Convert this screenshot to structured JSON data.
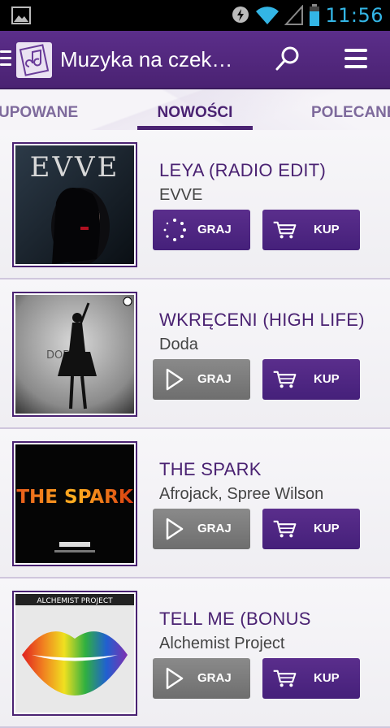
{
  "status_bar": {
    "time": "11:56",
    "icons": [
      "image-icon",
      "battery-saver-icon",
      "wifi-icon",
      "signal-icon",
      "battery-icon"
    ]
  },
  "action_bar": {
    "title": "Muzyka na czek…",
    "icons": [
      "app-music-icon",
      "search-icon",
      "menu-icon"
    ]
  },
  "tabs": [
    {
      "label": "UPOWANE"
    },
    {
      "label": "NOWOŚCI"
    },
    {
      "label": "POLECANE"
    }
  ],
  "songs": [
    {
      "title": "LEYA (RADIO EDIT)",
      "artist": "EVVE",
      "play_label": "GRAJ",
      "buy_label": "KUP",
      "play_state": "loading",
      "cover_text": "EVVE"
    },
    {
      "title": "WKRĘCENI (HIGH LIFE)",
      "artist": "Doda",
      "play_label": "GRAJ",
      "buy_label": "KUP",
      "play_state": "idle",
      "cover_text": "DODA"
    },
    {
      "title": "THE SPARK",
      "artist": "Afrojack, Spree Wilson",
      "play_label": "GRAJ",
      "buy_label": "KUP",
      "play_state": "idle",
      "cover_text": "THE SPARK"
    },
    {
      "title": "TELL ME (BONUS",
      "artist": "Alchemist Project",
      "play_label": "GRAJ",
      "buy_label": "KUP",
      "play_state": "idle",
      "cover_text": "ALCHEMIST PROJECT"
    }
  ],
  "colors": {
    "brand": "#4a2272",
    "play_inactive": "#7a7a7a"
  }
}
